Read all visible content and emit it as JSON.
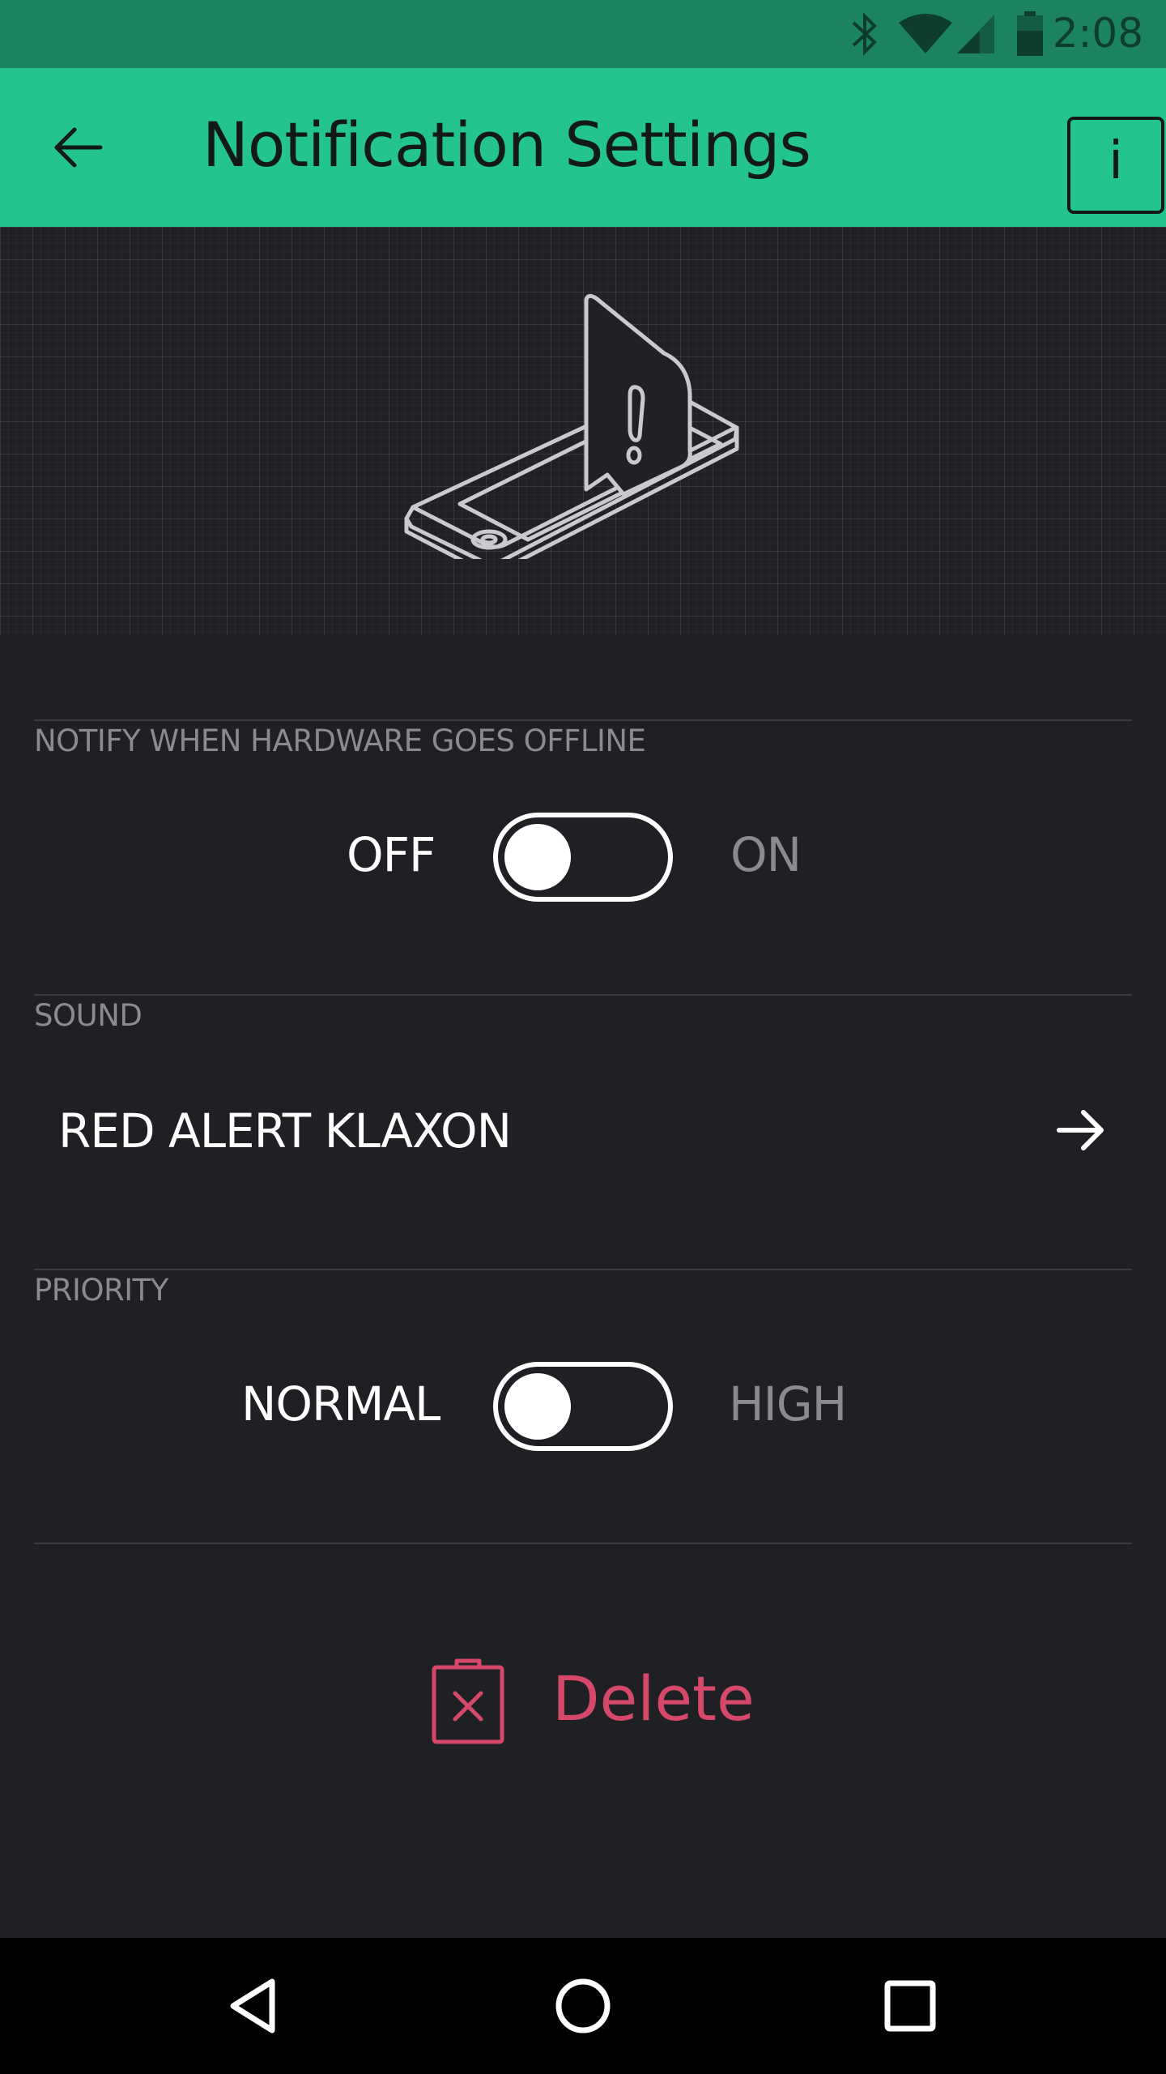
{
  "status_bar": {
    "time": "2:08",
    "icons": [
      "bluetooth-icon",
      "wifi-icon",
      "signal-icon",
      "battery-icon"
    ],
    "background": "#1b8361"
  },
  "app_bar": {
    "title": "Notification Settings",
    "back_icon": "arrow-left-icon",
    "info_label": "i",
    "background": "#23c48e"
  },
  "hero": {
    "illustration": "phone-alert-icon"
  },
  "offline_section": {
    "label": "NOTIFY WHEN HARDWARE GOES OFFLINE",
    "off_label": "OFF",
    "on_label": "ON",
    "state": "off"
  },
  "sound_section": {
    "label": "SOUND",
    "value": "RED ALERT KLAXON",
    "arrow_icon": "arrow-right-icon"
  },
  "priority_section": {
    "label": "PRIORITY",
    "normal_label": "NORMAL",
    "high_label": "HIGH",
    "state": "normal"
  },
  "delete": {
    "label": "Delete",
    "icon": "trash-icon",
    "color": "#d6486a"
  },
  "nav_bar": {
    "icons": [
      "back-triangle-icon",
      "home-circle-icon",
      "recents-square-icon"
    ]
  }
}
